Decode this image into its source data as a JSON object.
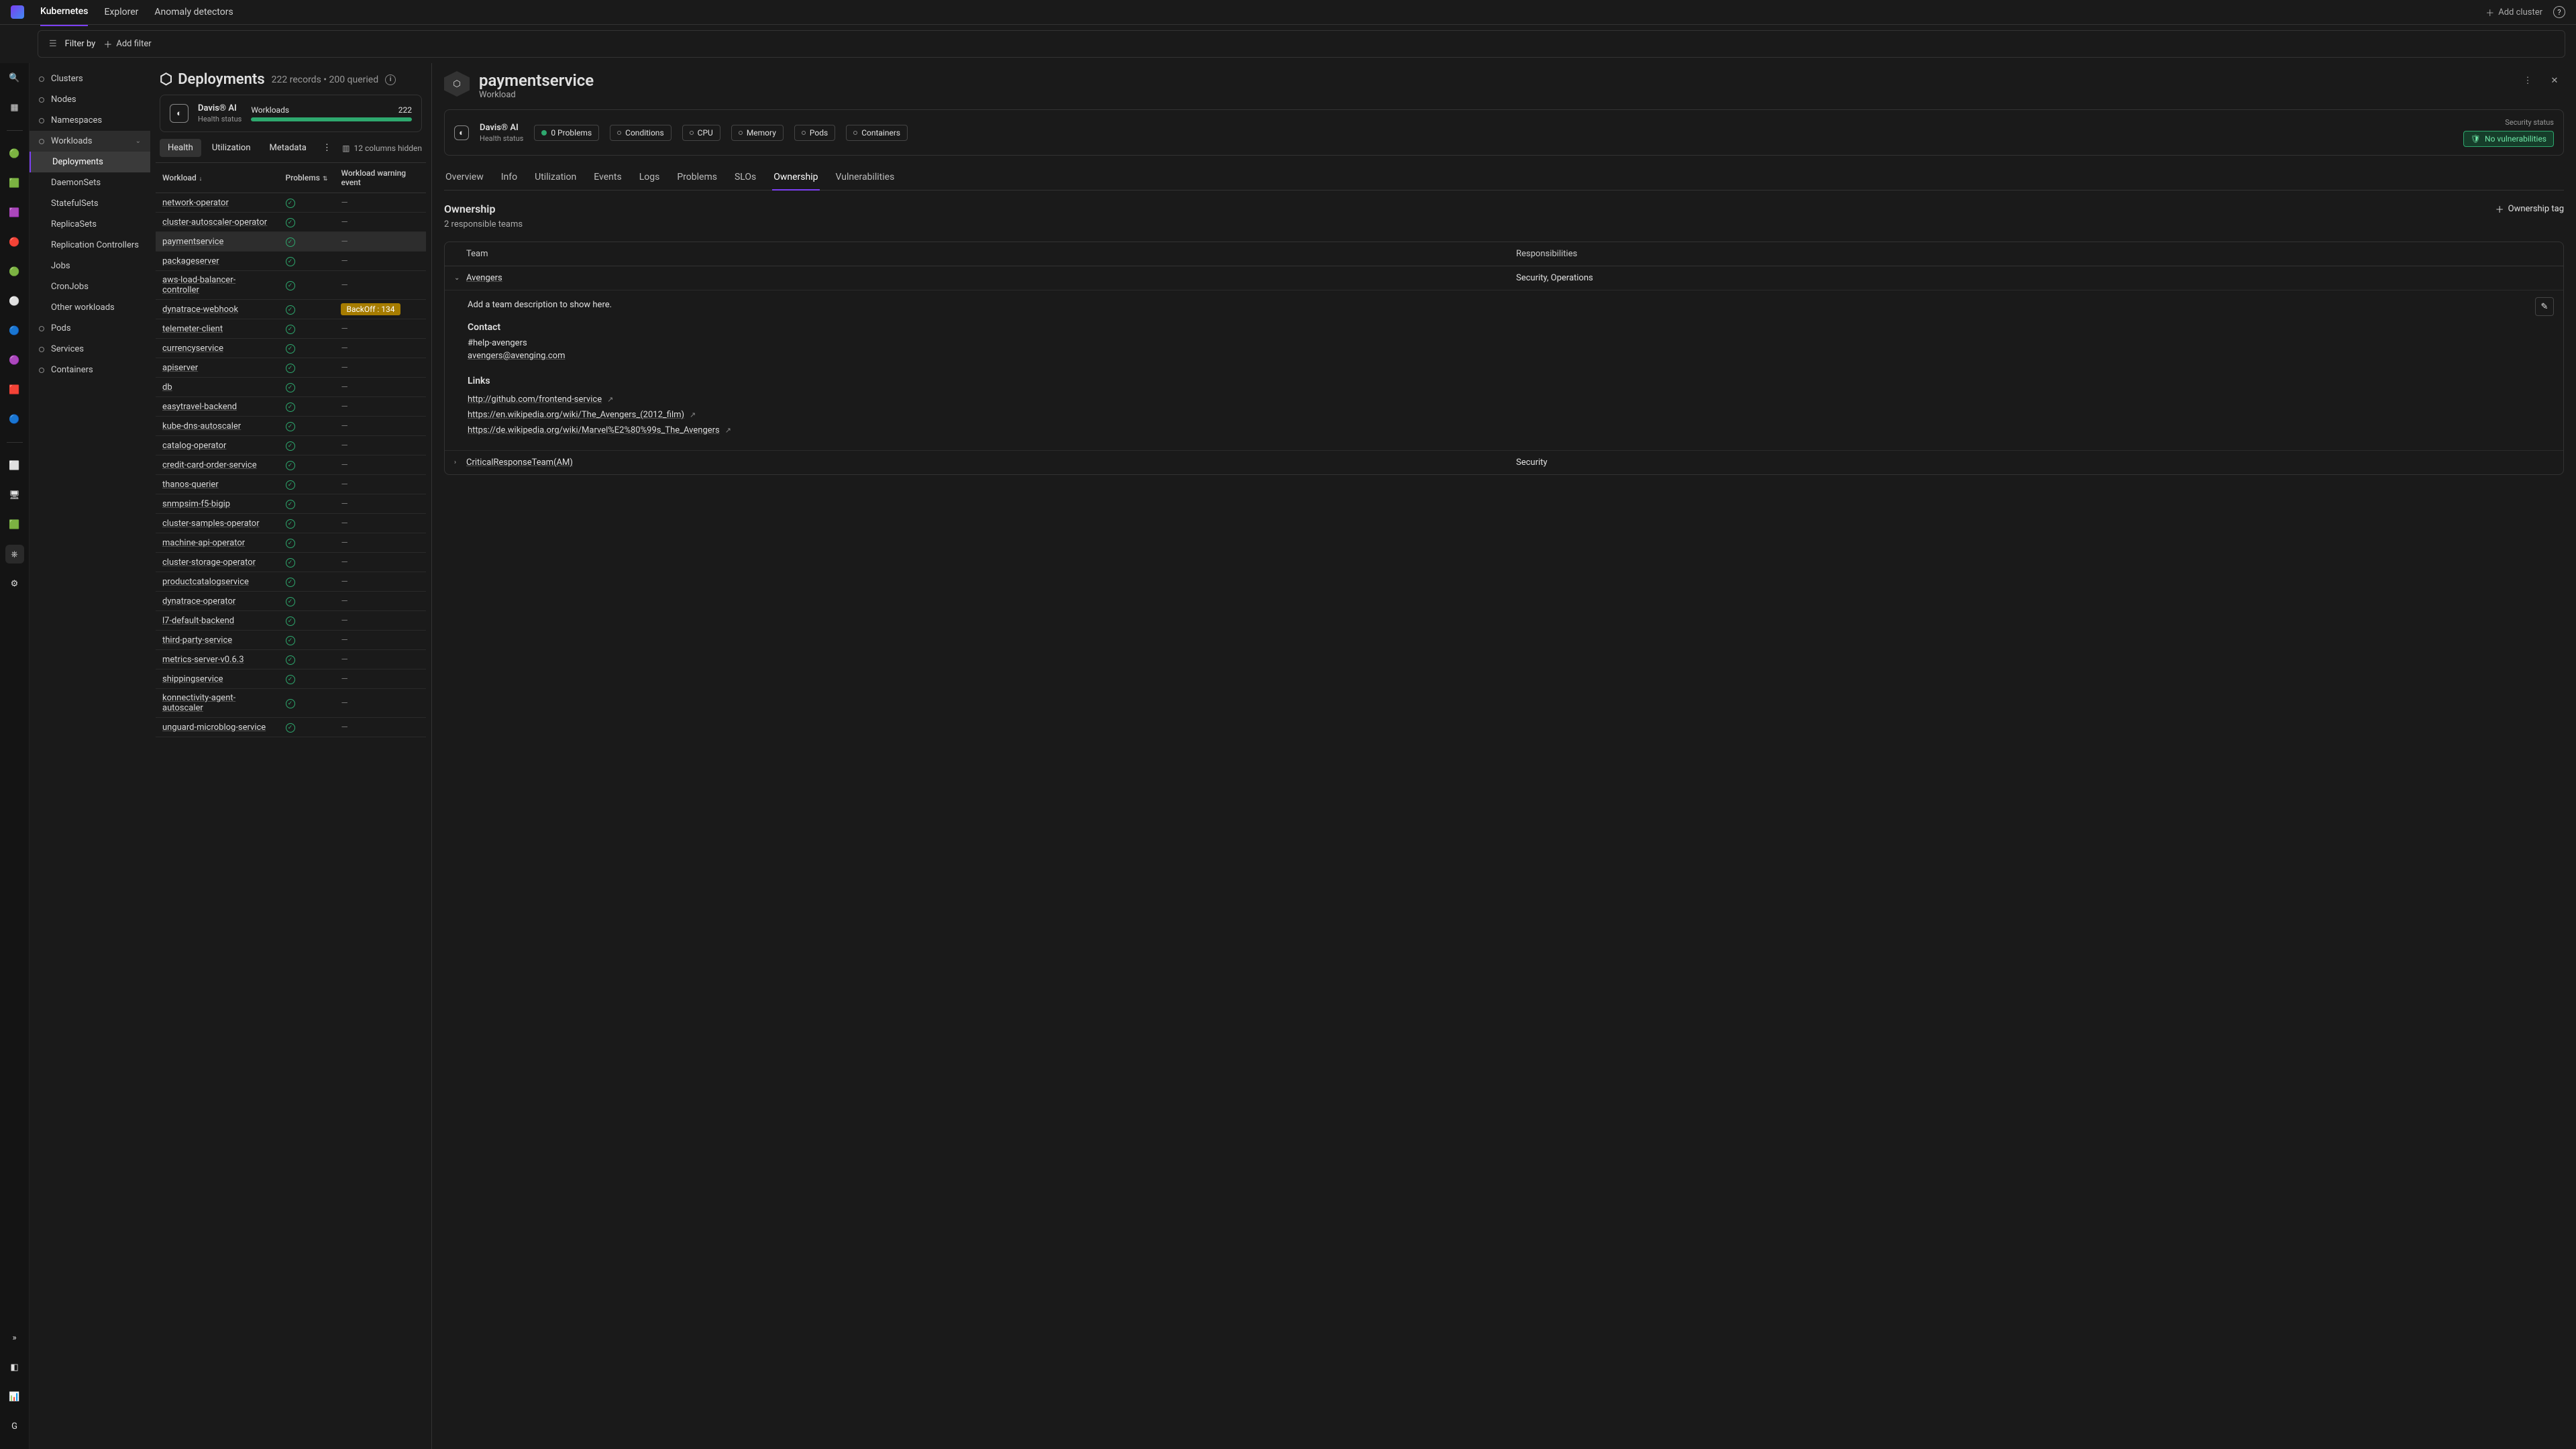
{
  "topnav": {
    "items": [
      "Kubernetes",
      "Explorer",
      "Anomaly detectors"
    ],
    "active": 0
  },
  "topright": {
    "add_cluster": "Add cluster"
  },
  "filterbar": {
    "label": "Filter by",
    "add_filter": "Add filter"
  },
  "sidebar": {
    "items": [
      {
        "label": "Clusters"
      },
      {
        "label": "Nodes"
      },
      {
        "label": "Namespaces"
      },
      {
        "label": "Workloads",
        "expanded": true,
        "children": [
          "Deployments",
          "DaemonSets",
          "StatefulSets",
          "ReplicaSets",
          "Replication Controllers",
          "Jobs",
          "CronJobs",
          "Other workloads"
        ],
        "active_child": 0
      },
      {
        "label": "Pods"
      },
      {
        "label": "Services"
      },
      {
        "label": "Containers"
      }
    ]
  },
  "list": {
    "title": "Deployments",
    "count_text": "222 records • 200 queried",
    "davis": {
      "title": "Davis® AI",
      "sub": "Health status",
      "bar_label": "Workloads",
      "bar_value": "222"
    },
    "seg_tabs": [
      "Health",
      "Utilization",
      "Metadata"
    ],
    "active_seg": 0,
    "cols_hidden": "12 columns hidden",
    "columns": [
      "Workload",
      "Problems",
      "Workload warning event"
    ],
    "rows": [
      {
        "name": "network-operator",
        "warn": null
      },
      {
        "name": "cluster-autoscaler-operator",
        "warn": null
      },
      {
        "name": "paymentservice",
        "warn": null,
        "selected": true
      },
      {
        "name": "packageserver",
        "warn": null
      },
      {
        "name": "aws-load-balancer-controller",
        "warn": null
      },
      {
        "name": "dynatrace-webhook",
        "warn": "BackOff : 134"
      },
      {
        "name": "telemeter-client",
        "warn": null
      },
      {
        "name": "currencyservice",
        "warn": null
      },
      {
        "name": "apiserver",
        "warn": null
      },
      {
        "name": "db",
        "warn": null
      },
      {
        "name": "easytravel-backend",
        "warn": null
      },
      {
        "name": "kube-dns-autoscaler",
        "warn": null
      },
      {
        "name": "catalog-operator",
        "warn": null
      },
      {
        "name": "credit-card-order-service",
        "warn": null
      },
      {
        "name": "thanos-querier",
        "warn": null
      },
      {
        "name": "snmpsim-f5-bigip",
        "warn": null
      },
      {
        "name": "cluster-samples-operator",
        "warn": null
      },
      {
        "name": "machine-api-operator",
        "warn": null
      },
      {
        "name": "cluster-storage-operator",
        "warn": null
      },
      {
        "name": "productcatalogservice",
        "warn": null
      },
      {
        "name": "dynatrace-operator",
        "warn": null
      },
      {
        "name": "l7-default-backend",
        "warn": null
      },
      {
        "name": "third-party-service",
        "warn": null
      },
      {
        "name": "metrics-server-v0.6.3",
        "warn": null
      },
      {
        "name": "shippingservice",
        "warn": null
      },
      {
        "name": "konnectivity-agent-autoscaler",
        "warn": null
      },
      {
        "name": "unguard-microblog-service",
        "warn": null
      }
    ]
  },
  "detail": {
    "title": "paymentservice",
    "subtitle": "Workload",
    "davis": {
      "title": "Davis® AI",
      "sub": "Health status"
    },
    "pills": [
      "0 Problems",
      "Conditions",
      "CPU",
      "Memory",
      "Pods",
      "Containers"
    ],
    "sec_label": "Security status",
    "no_vuln": "No vulnerabilities",
    "tabs": [
      "Overview",
      "Info",
      "Utilization",
      "Events",
      "Logs",
      "Problems",
      "SLOs",
      "Ownership",
      "Vulnerabilities"
    ],
    "active_tab": 7,
    "ownership": {
      "title": "Ownership",
      "sub": "2 responsible teams",
      "tag_btn": "Ownership tag",
      "head_team": "Team",
      "head_resp": "Responsibilities",
      "teams": [
        {
          "name": "Avengers",
          "resp": "Security, Operations",
          "expanded": true,
          "desc": "Add a team description to show here.",
          "contact_title": "Contact",
          "contact_channel": "#help-avengers",
          "contact_email": "avengers@avenging.com",
          "links_title": "Links",
          "links": [
            "http://github.com/frontend-service",
            "https://en.wikipedia.org/wiki/The_Avengers_(2012_film)",
            "https://de.wikipedia.org/wiki/Marvel%E2%80%99s_The_Avengers"
          ]
        },
        {
          "name": "CriticalResponseTeam(AM)",
          "resp": "Security",
          "expanded": false
        }
      ]
    }
  }
}
